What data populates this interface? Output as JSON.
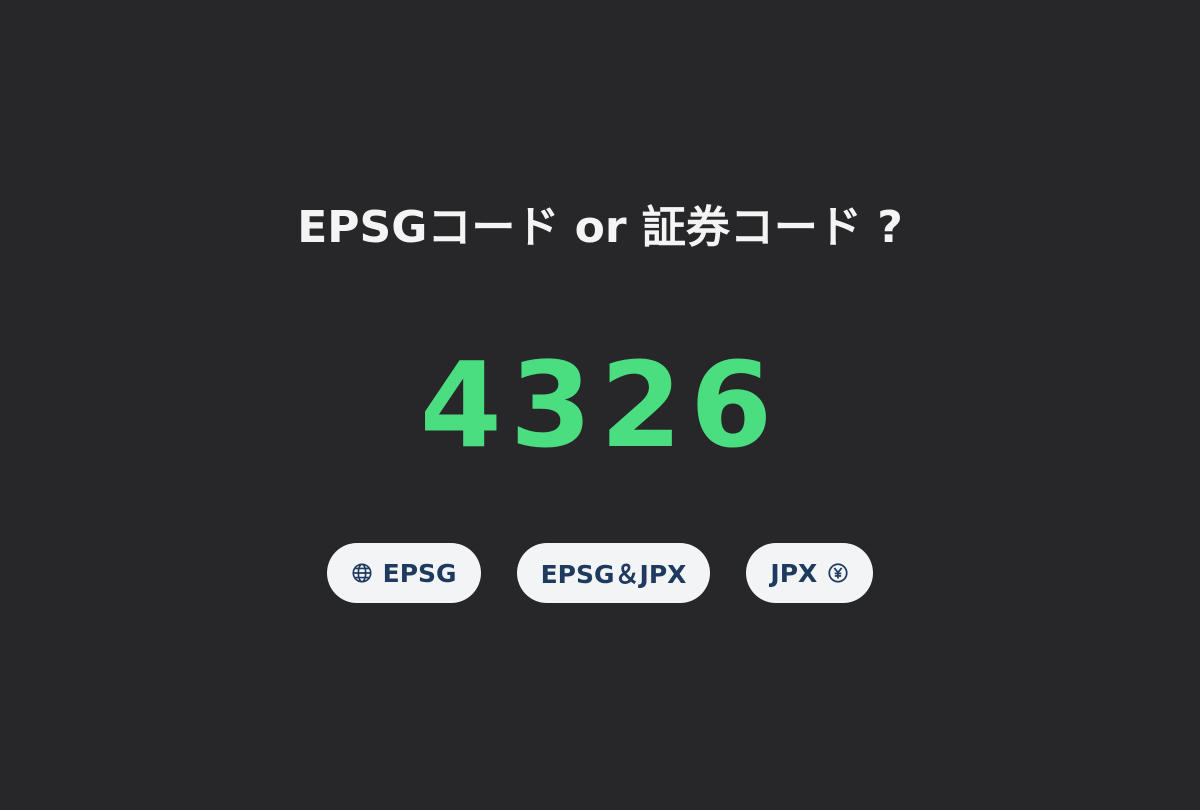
{
  "question": "EPSGコード or 証券コード ?",
  "code": "4326",
  "choices": [
    {
      "label": "EPSG",
      "icon": "globe-icon"
    },
    {
      "label": "EPSG＆JPX"
    },
    {
      "label": "JPX",
      "icon": "yen-icon"
    }
  ],
  "colors": {
    "background": "#27272a",
    "question_text": "#f4f4f5",
    "code_text": "#4ade80",
    "button_bg": "#f3f4f6",
    "button_text": "#1f3a5f"
  }
}
